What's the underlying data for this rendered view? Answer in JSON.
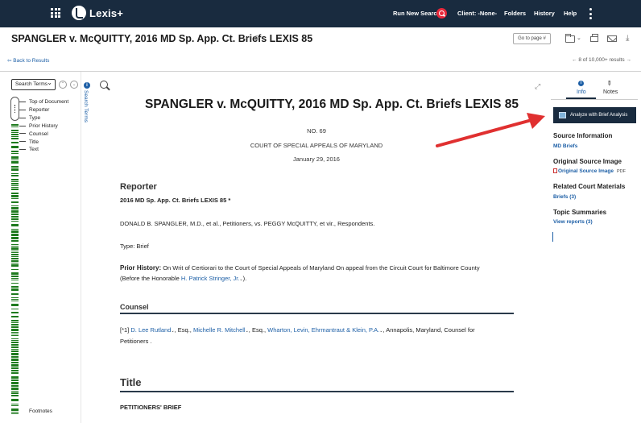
{
  "nav": {
    "logo": "Lexis+",
    "run_new_search": "Run New Search",
    "client": "Client: -None-",
    "folders": "Folders",
    "history": "History",
    "help": "Help"
  },
  "titlebar": {
    "title": "SPANGLER v. McQUITTY, 2016 MD Sp. App. Ct. Briefs LEXIS 85",
    "goto_page": "Go to page #"
  },
  "results": {
    "back": "Back to Results",
    "position": "8 of 10,000+ results"
  },
  "left_rail": {
    "search_terms_select": "Search Terms",
    "search_terms_tab": "Search Terms",
    "outline": [
      "Top of Document",
      "Reporter",
      "Type",
      "Prior History",
      "Counsel",
      "Title",
      "Text"
    ],
    "footnotes": "Footnotes"
  },
  "document": {
    "heading": "SPANGLER v. McQUITTY, 2016 MD Sp. App. Ct. Briefs LEXIS 85",
    "number": "NO. 69",
    "court": "COURT OF SPECIAL APPEALS OF MARYLAND",
    "date": "January 29, 2016",
    "reporter_heading": "Reporter",
    "reporter_cite": "2016 MD Sp. App. Ct. Briefs LEXIS 85 *",
    "parties": "DONALD B. SPANGLER, M.D., et al., Petitioners, vs. PEGGY McQUITTY, et vir., Respondents.",
    "type": "Type: Brief",
    "prior_history_label": "Prior History:",
    "prior_history_text": "On Writ of Certiorari to the Court of Special Appeals of Maryland On appeal from the Circuit Court for Baltimore County",
    "prior_history_line2_pre": "(Before the Honorable",
    "prior_history_judge": "H. Patrick Stringer, Jr.",
    "prior_history_line2_post": ").",
    "counsel_heading": "Counsel",
    "counsel_star": "[*1]",
    "counsel_name1": "D. Lee Rutland",
    "counsel_sep1": ", Esq.,",
    "counsel_name2": "Michelle R. Mitchell",
    "counsel_sep2": ", Esq.,",
    "counsel_firm": "Wharton, Levin, Ehrmantraut & Klein, P.A.",
    "counsel_rest": ", Annapolis, Maryland,  Counsel for",
    "counsel_line2": "Petitioners .",
    "title_heading": "Title",
    "brief_title": "PETITIONERS' BRIEF"
  },
  "right_panel": {
    "tab_info": "Info",
    "tab_notes": "Notes",
    "analyze_button": "Analyze with Brief Analysis",
    "source_info_heading": "Source Information",
    "source_info_link": "MD Briefs",
    "original_image_heading": "Original Source Image",
    "original_image_link": "Original Source Image",
    "original_image_format": "PDF",
    "related_heading": "Related Court Materials",
    "related_link": "Briefs (3)",
    "topic_heading": "Topic Summaries",
    "topic_link": "View reports (3)"
  },
  "colors": {
    "topbar": "#192b3f",
    "link": "#1d5fa6",
    "hit_marker": "#1e7a1e",
    "arrow": "#e03030"
  }
}
